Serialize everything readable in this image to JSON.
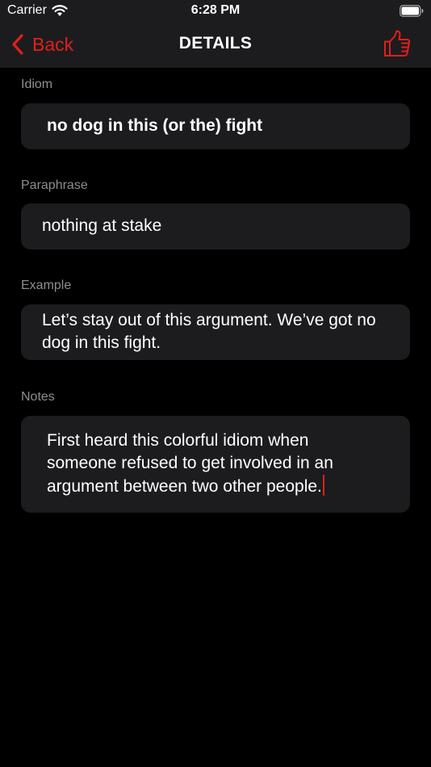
{
  "status_bar": {
    "carrier": "Carrier",
    "time": "6:28 PM"
  },
  "nav": {
    "back_label": "Back",
    "title": "DETAILS"
  },
  "sections": {
    "idiom": {
      "label": "Idiom",
      "value": "no dog in this (or the) fight"
    },
    "paraphrase": {
      "label": "Paraphrase",
      "value": "nothing at stake"
    },
    "example": {
      "label": "Example",
      "value": "Let’s stay out of this argument. We’ve got no dog in this fight."
    },
    "notes": {
      "label": "Notes",
      "value": "First heard this colorful idiom when someone refused to get involved in an argument between two other people."
    }
  },
  "colors": {
    "accent": "#e0201c",
    "background": "#000000",
    "card": "#1c1c1e",
    "label": "#8e8e93"
  },
  "icons": {
    "back": "chevron-left-icon",
    "like": "thumbs-up-icon",
    "wifi": "wifi-icon",
    "battery": "battery-icon"
  }
}
